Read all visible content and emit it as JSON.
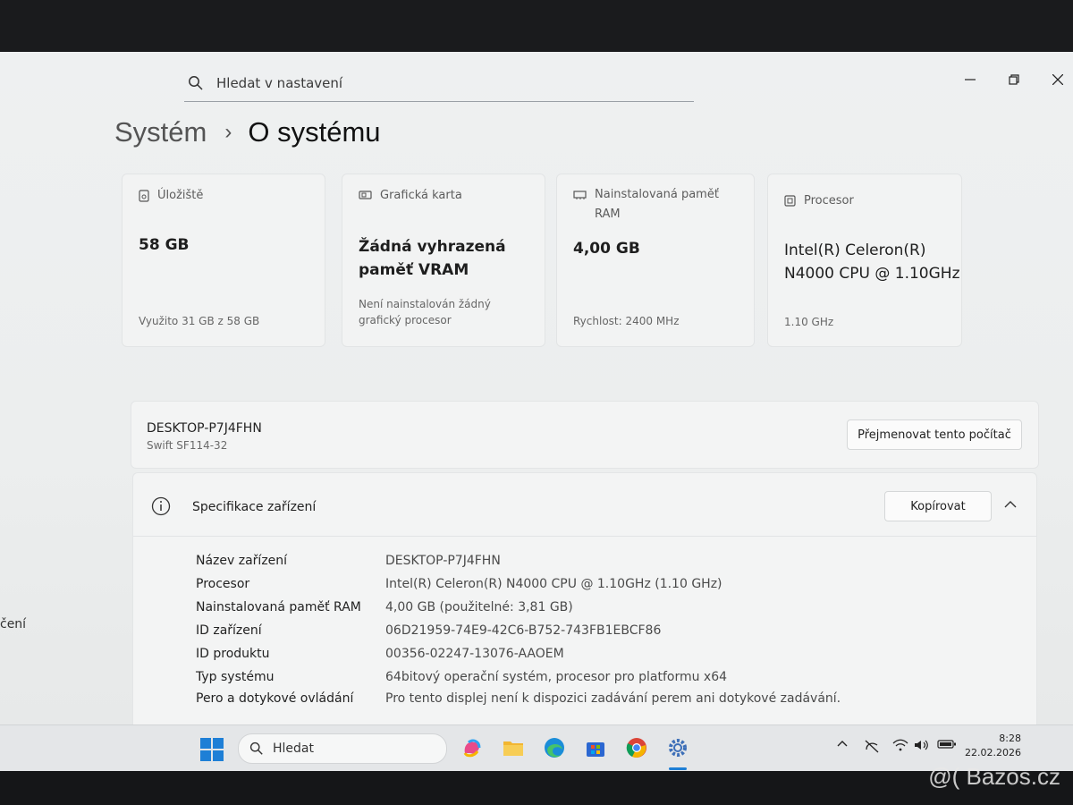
{
  "search": {
    "placeholder": "Hledat v nastavení"
  },
  "breadcrumb": {
    "parent": "Systém",
    "current": "O systému"
  },
  "cards": {
    "storage": {
      "label": "Úložiště",
      "value": "58 GB",
      "sub": "Využito 31 GB z 58 GB"
    },
    "gpu": {
      "label": "Grafická karta",
      "value_line1": "Žádná vyhrazená",
      "value_line2": "paměť VRAM",
      "sub_line1": "Není nainstalován žádný",
      "sub_line2": "grafický procesor"
    },
    "ram": {
      "label_line1": "Nainstalovaná paměť",
      "label_line2": "RAM",
      "value": "4,00 GB",
      "sub": "Rychlost: 2400 MHz"
    },
    "cpu": {
      "label": "Procesor",
      "value_line1": "Intel(R) Celeron(R)",
      "value_line2": "N4000 CPU @ 1.10GHz",
      "sub": "1.10 GHz"
    }
  },
  "device": {
    "name": "DESKTOP-P7J4FHN",
    "model": "Swift SF114-32",
    "rename_label": "Přejmenovat tento počítač"
  },
  "specs": {
    "title": "Specifikace zařízení",
    "copy_label": "Kopírovat",
    "rows": [
      {
        "key": "Název zařízení",
        "value": "DESKTOP-P7J4FHN"
      },
      {
        "key": "Procesor",
        "value": "Intel(R) Celeron(R) N4000 CPU @ 1.10GHz (1.10 GHz)"
      },
      {
        "key": "Nainstalovaná paměť RAM",
        "value": "4,00 GB (použitelné: 3,81 GB)"
      },
      {
        "key": "ID zařízení",
        "value": "06D21959-74E9-42C6-B752-743FB1EBCF86"
      },
      {
        "key": "ID produktu",
        "value": "00356-02247-13076-AAOEM"
      },
      {
        "key": "Typ systému",
        "value": "64bitový operační systém, procesor pro platformu x64"
      },
      {
        "key": "Pero a dotykové ovládání",
        "value": "Pro tento displej není k dispozici zadávání perem ani dotykové zadávání."
      }
    ]
  },
  "sidebar_fragment": "čení",
  "taskbar": {
    "search_label": "Hledat",
    "time": "8:28",
    "date": "22.02.2026"
  },
  "watermark": "@( Bazos.cz",
  "colors": {
    "accent": "#0067c0",
    "card_bg": "#f2f3f3",
    "screen_bg": "#eceeee"
  }
}
